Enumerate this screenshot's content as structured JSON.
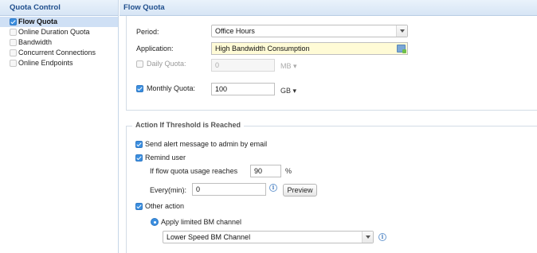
{
  "nav": {
    "title": "Quota Control",
    "items": [
      {
        "label": "Flow Quota"
      },
      {
        "label": "Online Duration Quota"
      },
      {
        "label": "Bandwidth"
      },
      {
        "label": "Concurrent Connections"
      },
      {
        "label": "Online Endpoints"
      }
    ]
  },
  "main": {
    "title": "Flow Quota",
    "period": {
      "label": "Period:",
      "value": "Office Hours"
    },
    "application": {
      "label": "Application:",
      "value": "High Bandwidth Consumption"
    },
    "daily_quota": {
      "label": "Daily Quota:",
      "value": "0",
      "unit": "MB ▾"
    },
    "monthly_quota": {
      "label": "Monthly Quota:",
      "value": "100",
      "unit": "GB ▾"
    },
    "threshold": {
      "title": "Action If Threshold is Reached",
      "send_alert": "Send alert message to admin by email",
      "remind_user": "Remind user",
      "usage_prefix": "If flow quota usage reaches",
      "usage_value": "90",
      "usage_unit": "%",
      "every_label": "Every(min):",
      "every_value": "0",
      "preview_label": "Preview",
      "other_action": "Other action",
      "apply_channel": "Apply limited BM channel",
      "channel_value": "Lower Speed BM Channel"
    }
  },
  "colors": {
    "accent": "#3b8fe0",
    "header_text": "#1f4e8c",
    "highlight": "#fffbd6"
  }
}
